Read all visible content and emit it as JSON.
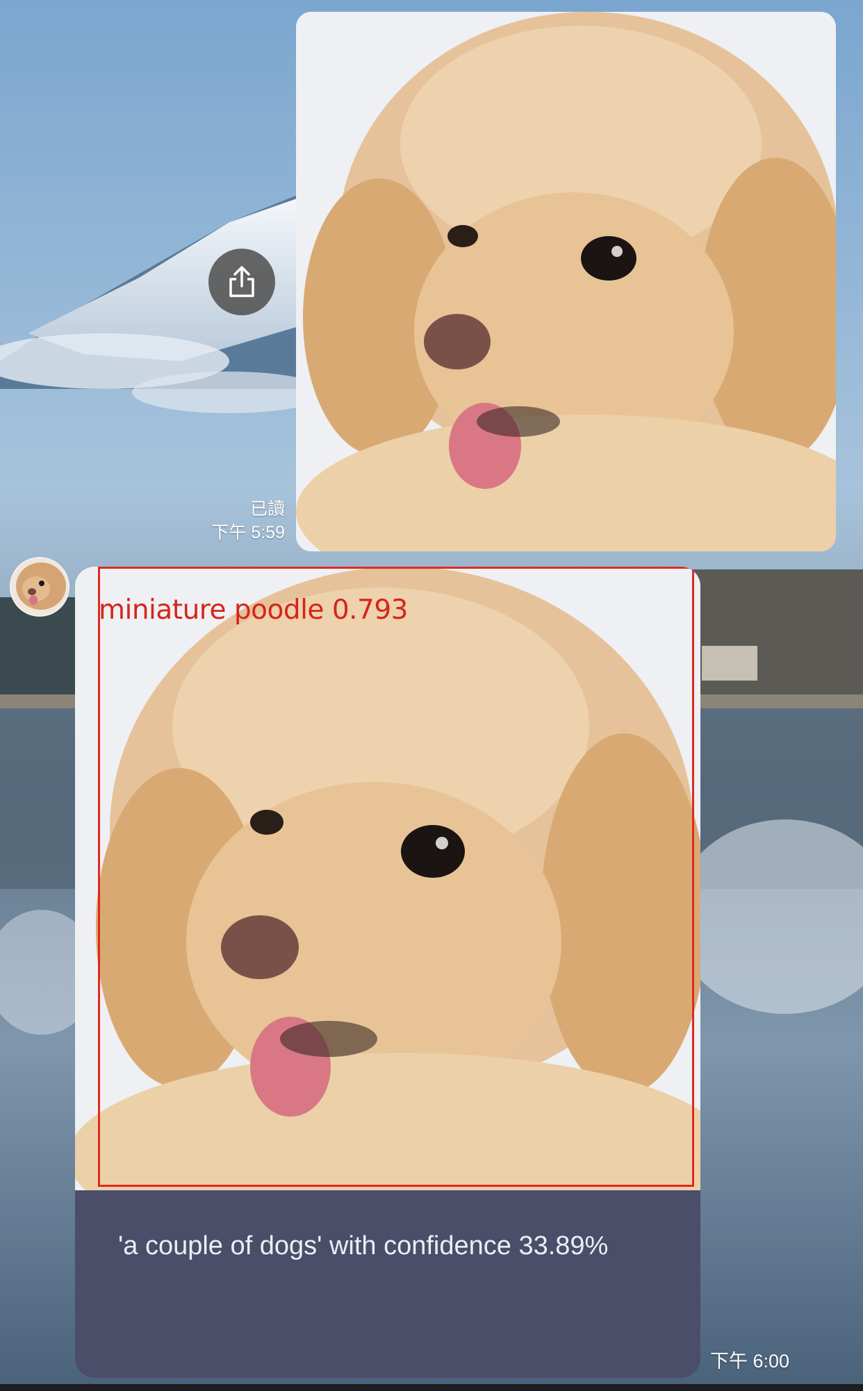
{
  "wallpaper": {
    "description_icon": "lake-mountain-wallpaper"
  },
  "outgoing_message": {
    "image_icon": "poodle-photo",
    "share_icon": "share-icon",
    "read_status": "已讀",
    "timestamp": "下午 5:59"
  },
  "incoming_message": {
    "avatar_icon": "poodle-avatar",
    "detection_label": "miniature poodle 0.793",
    "caption": "'a couple of dogs' with confidence 33.89%",
    "timestamp": "下午 6:00"
  },
  "colors": {
    "bbox": "#e02a1f",
    "card_background": "#4a4e69",
    "share_button": "#555555"
  }
}
